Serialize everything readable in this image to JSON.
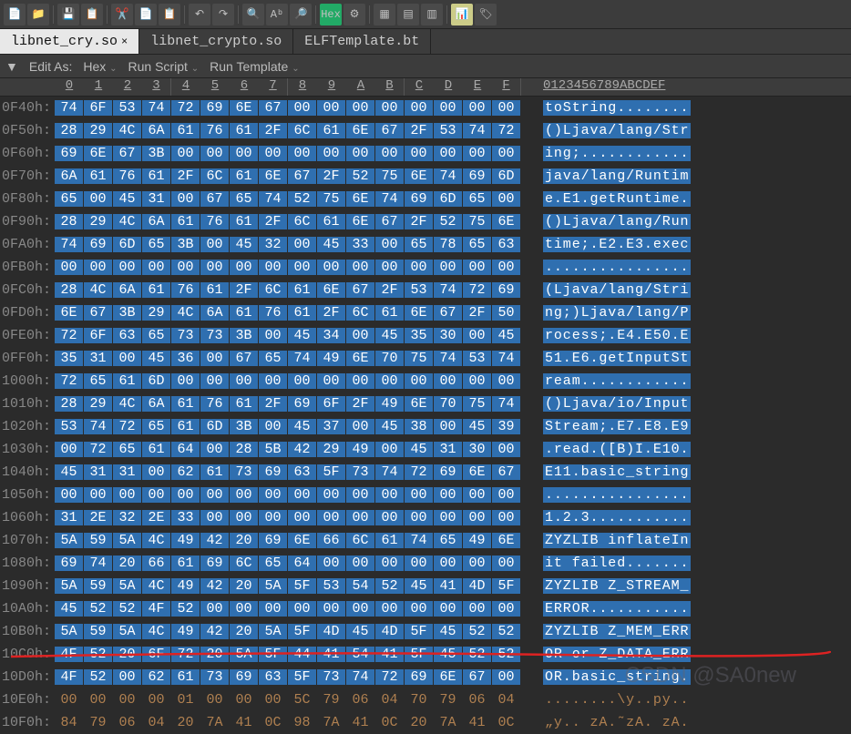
{
  "tabs": [
    {
      "label": "libnet_cry.so",
      "active": true,
      "close": "×"
    },
    {
      "label": "libnet_crypto.so",
      "active": false
    },
    {
      "label": "ELFTemplate.bt",
      "active": false
    }
  ],
  "edit_bar": {
    "arrow": "▼",
    "edit_as": "Edit As:",
    "edit_mode": "Hex",
    "run_script": "Run Script",
    "run_template": "Run Template",
    "chev": "⌄"
  },
  "col_headers": [
    "0",
    "1",
    "2",
    "3",
    "4",
    "5",
    "6",
    "7",
    "8",
    "9",
    "A",
    "B",
    "C",
    "D",
    "E",
    "F"
  ],
  "ascii_header": "0123456789ABCDEF",
  "rows": [
    {
      "addr": "0F40h:",
      "sel": true,
      "bytes": [
        "74",
        "6F",
        "53",
        "74",
        "72",
        "69",
        "6E",
        "67",
        "00",
        "00",
        "00",
        "00",
        "00",
        "00",
        "00",
        "00"
      ],
      "ascii": "toString........"
    },
    {
      "addr": "0F50h:",
      "sel": true,
      "bytes": [
        "28",
        "29",
        "4C",
        "6A",
        "61",
        "76",
        "61",
        "2F",
        "6C",
        "61",
        "6E",
        "67",
        "2F",
        "53",
        "74",
        "72"
      ],
      "ascii": "()Ljava/lang/Str"
    },
    {
      "addr": "0F60h:",
      "sel": true,
      "bytes": [
        "69",
        "6E",
        "67",
        "3B",
        "00",
        "00",
        "00",
        "00",
        "00",
        "00",
        "00",
        "00",
        "00",
        "00",
        "00",
        "00"
      ],
      "ascii": "ing;............"
    },
    {
      "addr": "0F70h:",
      "sel": true,
      "bytes": [
        "6A",
        "61",
        "76",
        "61",
        "2F",
        "6C",
        "61",
        "6E",
        "67",
        "2F",
        "52",
        "75",
        "6E",
        "74",
        "69",
        "6D"
      ],
      "ascii": "java/lang/Runtim"
    },
    {
      "addr": "0F80h:",
      "sel": true,
      "bytes": [
        "65",
        "00",
        "45",
        "31",
        "00",
        "67",
        "65",
        "74",
        "52",
        "75",
        "6E",
        "74",
        "69",
        "6D",
        "65",
        "00"
      ],
      "ascii": "e.E1.getRuntime."
    },
    {
      "addr": "0F90h:",
      "sel": true,
      "bytes": [
        "28",
        "29",
        "4C",
        "6A",
        "61",
        "76",
        "61",
        "2F",
        "6C",
        "61",
        "6E",
        "67",
        "2F",
        "52",
        "75",
        "6E"
      ],
      "ascii": "()Ljava/lang/Run"
    },
    {
      "addr": "0FA0h:",
      "sel": true,
      "bytes": [
        "74",
        "69",
        "6D",
        "65",
        "3B",
        "00",
        "45",
        "32",
        "00",
        "45",
        "33",
        "00",
        "65",
        "78",
        "65",
        "63"
      ],
      "ascii": "time;.E2.E3.exec"
    },
    {
      "addr": "0FB0h:",
      "sel": true,
      "bytes": [
        "00",
        "00",
        "00",
        "00",
        "00",
        "00",
        "00",
        "00",
        "00",
        "00",
        "00",
        "00",
        "00",
        "00",
        "00",
        "00"
      ],
      "ascii": "................"
    },
    {
      "addr": "0FC0h:",
      "sel": true,
      "bytes": [
        "28",
        "4C",
        "6A",
        "61",
        "76",
        "61",
        "2F",
        "6C",
        "61",
        "6E",
        "67",
        "2F",
        "53",
        "74",
        "72",
        "69"
      ],
      "ascii": "(Ljava/lang/Stri"
    },
    {
      "addr": "0FD0h:",
      "sel": true,
      "bytes": [
        "6E",
        "67",
        "3B",
        "29",
        "4C",
        "6A",
        "61",
        "76",
        "61",
        "2F",
        "6C",
        "61",
        "6E",
        "67",
        "2F",
        "50"
      ],
      "ascii": "ng;)Ljava/lang/P"
    },
    {
      "addr": "0FE0h:",
      "sel": true,
      "bytes": [
        "72",
        "6F",
        "63",
        "65",
        "73",
        "73",
        "3B",
        "00",
        "45",
        "34",
        "00",
        "45",
        "35",
        "30",
        "00",
        "45"
      ],
      "ascii": "rocess;.E4.E50.E"
    },
    {
      "addr": "0FF0h:",
      "sel": true,
      "bytes": [
        "35",
        "31",
        "00",
        "45",
        "36",
        "00",
        "67",
        "65",
        "74",
        "49",
        "6E",
        "70",
        "75",
        "74",
        "53",
        "74"
      ],
      "ascii": "51.E6.getInputSt"
    },
    {
      "addr": "1000h:",
      "sel": true,
      "bytes": [
        "72",
        "65",
        "61",
        "6D",
        "00",
        "00",
        "00",
        "00",
        "00",
        "00",
        "00",
        "00",
        "00",
        "00",
        "00",
        "00"
      ],
      "ascii": "ream............"
    },
    {
      "addr": "1010h:",
      "sel": true,
      "bytes": [
        "28",
        "29",
        "4C",
        "6A",
        "61",
        "76",
        "61",
        "2F",
        "69",
        "6F",
        "2F",
        "49",
        "6E",
        "70",
        "75",
        "74"
      ],
      "ascii": "()Ljava/io/Input"
    },
    {
      "addr": "1020h:",
      "sel": true,
      "bytes": [
        "53",
        "74",
        "72",
        "65",
        "61",
        "6D",
        "3B",
        "00",
        "45",
        "37",
        "00",
        "45",
        "38",
        "00",
        "45",
        "39"
      ],
      "ascii": "Stream;.E7.E8.E9"
    },
    {
      "addr": "1030h:",
      "sel": true,
      "bytes": [
        "00",
        "72",
        "65",
        "61",
        "64",
        "00",
        "28",
        "5B",
        "42",
        "29",
        "49",
        "00",
        "45",
        "31",
        "30",
        "00"
      ],
      "ascii": ".read.([B)I.E10."
    },
    {
      "addr": "1040h:",
      "sel": true,
      "bytes": [
        "45",
        "31",
        "31",
        "00",
        "62",
        "61",
        "73",
        "69",
        "63",
        "5F",
        "73",
        "74",
        "72",
        "69",
        "6E",
        "67"
      ],
      "ascii": "E11.basic_string"
    },
    {
      "addr": "1050h:",
      "sel": true,
      "bytes": [
        "00",
        "00",
        "00",
        "00",
        "00",
        "00",
        "00",
        "00",
        "00",
        "00",
        "00",
        "00",
        "00",
        "00",
        "00",
        "00"
      ],
      "ascii": "................"
    },
    {
      "addr": "1060h:",
      "sel": true,
      "bytes": [
        "31",
        "2E",
        "32",
        "2E",
        "33",
        "00",
        "00",
        "00",
        "00",
        "00",
        "00",
        "00",
        "00",
        "00",
        "00",
        "00"
      ],
      "ascii": "1.2.3..........."
    },
    {
      "addr": "1070h:",
      "sel": true,
      "bytes": [
        "5A",
        "59",
        "5A",
        "4C",
        "49",
        "42",
        "20",
        "69",
        "6E",
        "66",
        "6C",
        "61",
        "74",
        "65",
        "49",
        "6E"
      ],
      "ascii": "ZYZLIB inflateIn"
    },
    {
      "addr": "1080h:",
      "sel": true,
      "bytes": [
        "69",
        "74",
        "20",
        "66",
        "61",
        "69",
        "6C",
        "65",
        "64",
        "00",
        "00",
        "00",
        "00",
        "00",
        "00",
        "00"
      ],
      "ascii": "it failed......."
    },
    {
      "addr": "1090h:",
      "sel": true,
      "bytes": [
        "5A",
        "59",
        "5A",
        "4C",
        "49",
        "42",
        "20",
        "5A",
        "5F",
        "53",
        "54",
        "52",
        "45",
        "41",
        "4D",
        "5F"
      ],
      "ascii": "ZYZLIB Z_STREAM_"
    },
    {
      "addr": "10A0h:",
      "sel": true,
      "bytes": [
        "45",
        "52",
        "52",
        "4F",
        "52",
        "00",
        "00",
        "00",
        "00",
        "00",
        "00",
        "00",
        "00",
        "00",
        "00",
        "00"
      ],
      "ascii": "ERROR..........."
    },
    {
      "addr": "10B0h:",
      "sel": true,
      "bytes": [
        "5A",
        "59",
        "5A",
        "4C",
        "49",
        "42",
        "20",
        "5A",
        "5F",
        "4D",
        "45",
        "4D",
        "5F",
        "45",
        "52",
        "52"
      ],
      "ascii": "ZYZLIB Z_MEM_ERR"
    },
    {
      "addr": "10C0h:",
      "sel": true,
      "bytes": [
        "4F",
        "52",
        "20",
        "6F",
        "72",
        "20",
        "5A",
        "5F",
        "44",
        "41",
        "54",
        "41",
        "5F",
        "45",
        "52",
        "52"
      ],
      "ascii": "OR or Z_DATA_ERR"
    },
    {
      "addr": "10D0h:",
      "sel": true,
      "bytes": [
        "4F",
        "52",
        "00",
        "62",
        "61",
        "73",
        "69",
        "63",
        "5F",
        "73",
        "74",
        "72",
        "69",
        "6E",
        "67",
        "00"
      ],
      "ascii": "OR.basic_string."
    },
    {
      "addr": "10E0h:",
      "sel": false,
      "bytes": [
        "00",
        "00",
        "00",
        "00",
        "01",
        "00",
        "00",
        "00",
        "5C",
        "79",
        "06",
        "04",
        "70",
        "79",
        "06",
        "04"
      ],
      "ascii": "........\\y..py.."
    },
    {
      "addr": "10F0h:",
      "sel": false,
      "bytes": [
        "84",
        "79",
        "06",
        "04",
        "20",
        "7A",
        "41",
        "0C",
        "98",
        "7A",
        "41",
        "0C",
        "20",
        "7A",
        "41",
        "0C"
      ],
      "ascii": "„y.. zA.˜zA. zA."
    }
  ],
  "watermark1": "",
  "watermark2": "CSDN @SA0new"
}
